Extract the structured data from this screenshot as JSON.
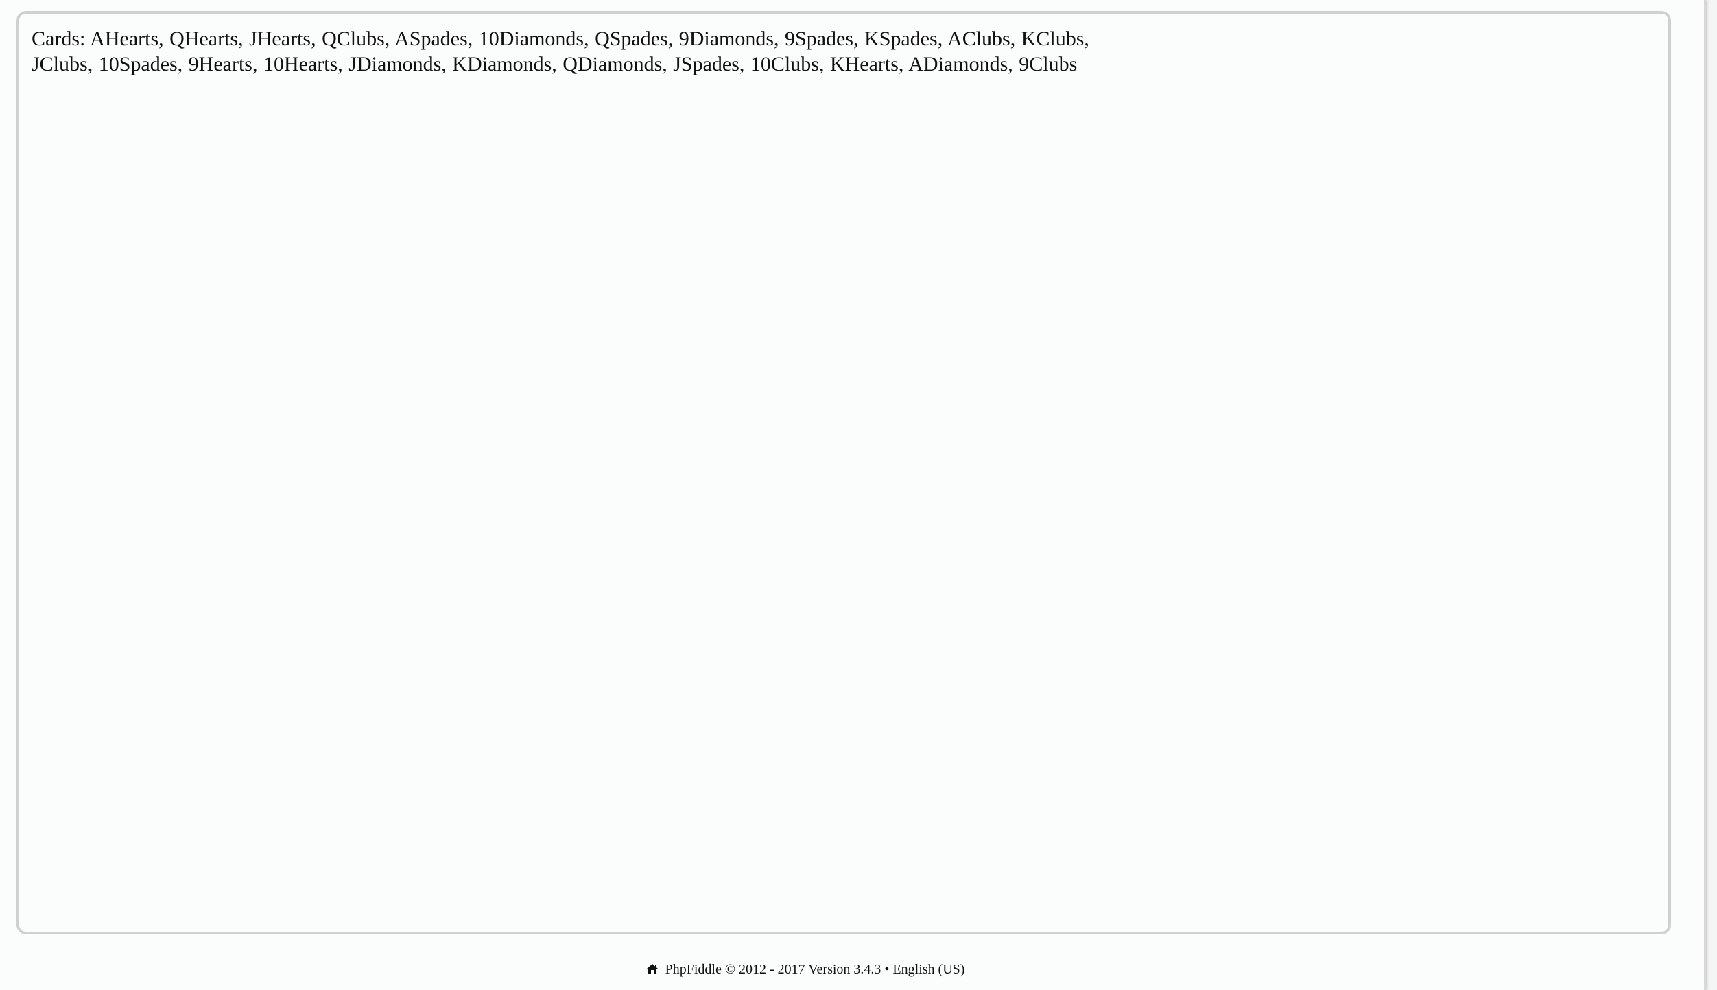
{
  "output": {
    "line1": "Cards: AHearts, QHearts, JHearts, QClubs, ASpades, 10Diamonds, QSpades, 9Diamonds, 9Spades, KSpades, AClubs, KClubs,",
    "line2": "JClubs, 10Spades, 9Hearts, 10Hearts, JDiamonds, KDiamonds, QDiamonds, JSpades, 10Clubs, KHearts, ADiamonds, 9Clubs"
  },
  "footer": {
    "icon": "home-icon",
    "text": "PhpFiddle © 2012 - 2017 Version 3.4.3 • English (US)"
  }
}
